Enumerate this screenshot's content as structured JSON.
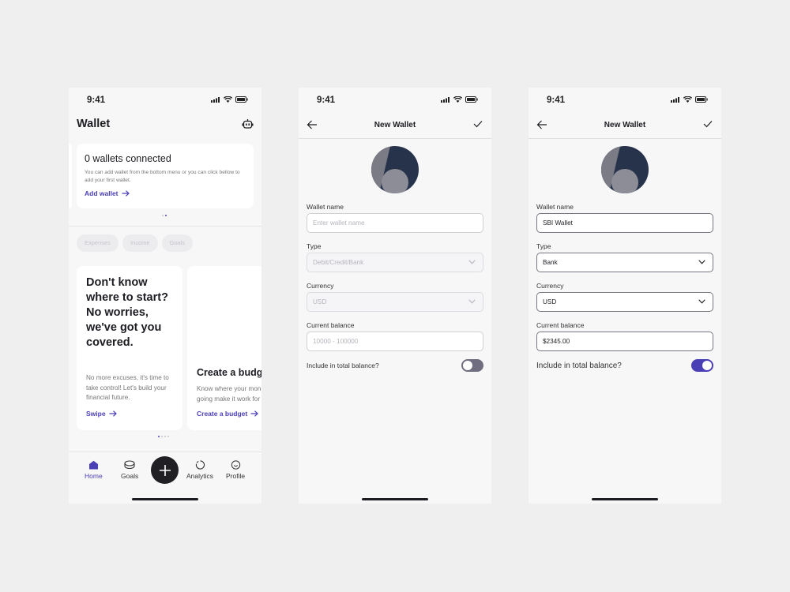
{
  "status": {
    "time": "9:41"
  },
  "screen1": {
    "title": "Wallet",
    "wallet_card": {
      "heading": "0 wallets connected",
      "body": "You can add wallet from the bottom menu or you can click bellow to add your first wallet.",
      "link": "Add wallet"
    },
    "chips": [
      "Expenses",
      "Income",
      "Goals"
    ],
    "tip_card": {
      "heading": "Don't know where to start? No worries, we've got you covered.",
      "body": "No more excuses, it's time to take control! Let's build your financial future.",
      "link": "Swipe"
    },
    "budget_card": {
      "heading": "Create a budget",
      "body_line1": "Know where your money is",
      "body_line2": "going make it work for you",
      "link": "Create a budget"
    },
    "nav": {
      "home": "Home",
      "goals": "Goals",
      "analytics": "Analytics",
      "profile": "Profile"
    }
  },
  "form": {
    "title": "New Wallet",
    "labels": {
      "wallet_name": "Wallet name",
      "type": "Type",
      "currency": "Currency",
      "balance": "Current balance",
      "include": "Include in total balance?"
    }
  },
  "screen2": {
    "wallet_name_placeholder": "Enter wallet name",
    "type_placeholder": "Debit/Credit/Bank",
    "currency_value": "USD",
    "balance_placeholder": "10000 - 100000",
    "include_on": false
  },
  "screen3": {
    "wallet_name": "SBI Wallet",
    "type": "Bank",
    "currency": "USD",
    "balance": "$2345.00",
    "include_on": true
  },
  "colors": {
    "accent": "#4a3fb5",
    "dark": "#1f1f24",
    "avatar": "#27334a",
    "toggle_off": "#6e6e80"
  }
}
